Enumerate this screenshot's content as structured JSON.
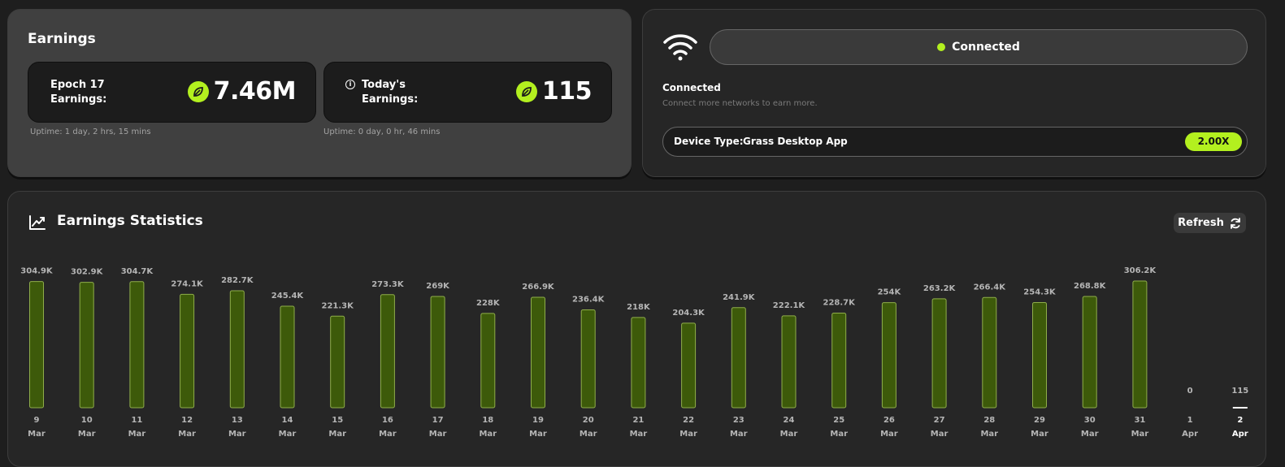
{
  "earnings": {
    "title": "Earnings",
    "epoch": {
      "label": "Epoch 17 Earnings:",
      "value": "7.46M",
      "uptime": "Uptime: 1 day, 2 hrs, 15 mins"
    },
    "today": {
      "label": "Today's Earnings:",
      "value": "115",
      "uptime": "Uptime: 0 day, 0 hr, 46 mins"
    }
  },
  "network": {
    "status_label": "Connected",
    "connection_title": "Connected",
    "connection_subtitle": "Connect more networks to earn more.",
    "device_label": "Device Type:",
    "device_value": "Grass Desktop App",
    "multiplier": "2.00X"
  },
  "stats": {
    "title": "Earnings Statistics",
    "refresh_label": "Refresh"
  },
  "colors": {
    "accent": "#b3f01f",
    "bar_fill": "#3d5a0a",
    "bar_border": "#8fae4a"
  },
  "chart_data": {
    "type": "bar",
    "categories": [
      "9 Mar",
      "10 Mar",
      "11 Mar",
      "12 Mar",
      "13 Mar",
      "14 Mar",
      "15 Mar",
      "16 Mar",
      "17 Mar",
      "18 Mar",
      "19 Mar",
      "20 Mar",
      "21 Mar",
      "22 Mar",
      "23 Mar",
      "24 Mar",
      "25 Mar",
      "26 Mar",
      "27 Mar",
      "28 Mar",
      "29 Mar",
      "30 Mar",
      "31 Mar",
      "1 Apr",
      "2 Apr"
    ],
    "day_labels": [
      "9",
      "10",
      "11",
      "12",
      "13",
      "14",
      "15",
      "16",
      "17",
      "18",
      "19",
      "20",
      "21",
      "22",
      "23",
      "24",
      "25",
      "26",
      "27",
      "28",
      "29",
      "30",
      "31",
      "1",
      "2"
    ],
    "month_labels": [
      "Mar",
      "Mar",
      "Mar",
      "Mar",
      "Mar",
      "Mar",
      "Mar",
      "Mar",
      "Mar",
      "Mar",
      "Mar",
      "Mar",
      "Mar",
      "Mar",
      "Mar",
      "Mar",
      "Mar",
      "Mar",
      "Mar",
      "Mar",
      "Mar",
      "Mar",
      "Mar",
      "Apr",
      "Apr"
    ],
    "values": [
      304900,
      302900,
      304700,
      274100,
      282700,
      245400,
      221300,
      273300,
      269000,
      228000,
      266900,
      236400,
      218000,
      204300,
      241900,
      222100,
      228700,
      254000,
      263200,
      266400,
      254300,
      268800,
      306200,
      0,
      115
    ],
    "data_labels": [
      "304.9K",
      "302.9K",
      "304.7K",
      "274.1K",
      "282.7K",
      "245.4K",
      "221.3K",
      "273.3K",
      "269K",
      "228K",
      "266.9K",
      "236.4K",
      "218K",
      "204.3K",
      "241.9K",
      "222.1K",
      "228.7K",
      "254K",
      "263.2K",
      "266.4K",
      "254.3K",
      "268.8K",
      "306.2K",
      "0",
      "115"
    ],
    "selected_index": 24,
    "ylim": [
      0,
      306200
    ]
  }
}
